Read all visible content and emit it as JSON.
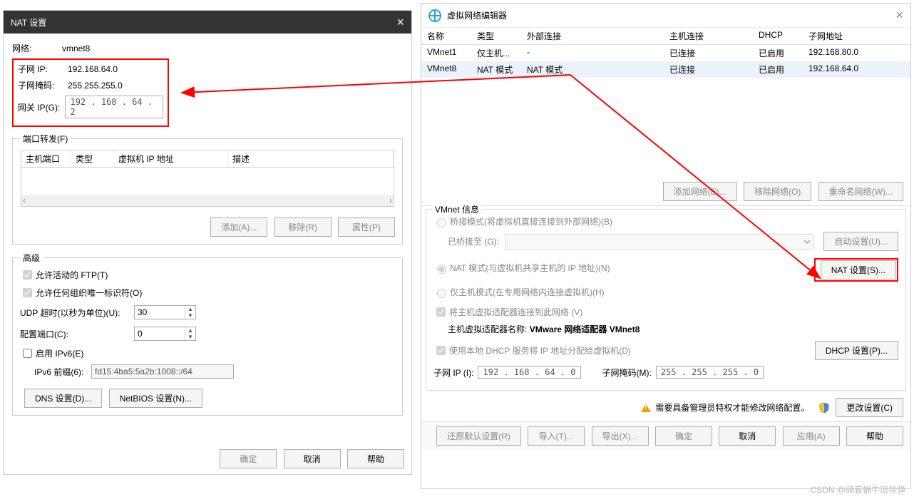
{
  "nat": {
    "title": "NAT 设置",
    "network_label": "网络:",
    "network_value": "vmnet8",
    "subnet_ip_label": "子网 IP:",
    "subnet_ip_value": "192.168.64.0",
    "subnet_mask_label": "子网掩码:",
    "subnet_mask_value": "255.255.255.0",
    "gateway_label": "网关 IP(G):",
    "gateway_value": "192 . 168 . 64  .  2",
    "port_fwd_legend": "端口转发(F)",
    "port_cols": {
      "host": "主机端口",
      "type": "类型",
      "vm_ip": "虚拟机 IP 地址",
      "desc": "描述"
    },
    "add_btn": "添加(A)...",
    "remove_btn": "移除(R)",
    "props_btn": "属性(P)",
    "advanced_legend": "高级",
    "allow_ftp": "允许活动的 FTP(T)",
    "allow_org": "允许任何组织唯一标识符(O)",
    "udp_timeout_label": "UDP 超时(以秒为单位)(U):",
    "udp_timeout_value": "30",
    "config_port_label": "配置端口(C):",
    "config_port_value": "0",
    "enable_ipv6": "启用 IPv6(E)",
    "ipv6_prefix_label": "IPv6 前缀(6):",
    "ipv6_prefix_value": "fd15:4ba5:5a2b:1008::/64",
    "dns_btn": "DNS 设置(D)...",
    "netbios_btn": "NetBIOS 设置(N)...",
    "ok": "确定",
    "cancel": "取消",
    "help": "帮助"
  },
  "vne": {
    "title": "虚拟网络编辑器",
    "cols": {
      "name": "名称",
      "type": "类型",
      "ext": "外部连接",
      "host": "主机连接",
      "dhcp": "DHCP",
      "subnet": "子网地址"
    },
    "rows": [
      {
        "name": "VMnet1",
        "type": "仅主机...",
        "ext": "-",
        "host": "已连接",
        "dhcp": "已启用",
        "subnet": "192.168.80.0"
      },
      {
        "name": "VMnet8",
        "type": "NAT 模式",
        "ext": "NAT 模式",
        "host": "已连接",
        "dhcp": "已启用",
        "subnet": "192.168.64.0"
      }
    ],
    "add_net": "添加网络(E)...",
    "remove_net": "移除网络(O)",
    "rename_net": "重命名网络(W)...",
    "info_label": "VMnet 信息",
    "bridge": "桥接模式(将虚拟机直接连接到外部网络)(B)",
    "bridge_to": "已桥接至 (G):",
    "auto_set": "自动设置(U)...",
    "nat_mode": "NAT 模式(与虚拟机共享主机的 IP 地址)(N)",
    "nat_set": "NAT 设置(S)...",
    "host_only": "仅主机模式(在专用网络内连接虚拟机)(H)",
    "host_adapter_chk": "将主机虚拟适配器连接到此网络 (V)",
    "host_adapter_name_label": "主机虚拟适配器名称:",
    "host_adapter_name_value": "VMware 网络适配器 VMnet8",
    "dhcp_chk": "使用本地 DHCP 服务将 IP 地址分配给虚拟机(D)",
    "dhcp_set": "DHCP 设置(P)...",
    "subnet_ip_label": "子网 IP (I):",
    "subnet_ip_value": "192 . 168 . 64 . 0",
    "subnet_mask_label": "子网掩码(M):",
    "subnet_mask_value": "255 . 255 . 255 . 0",
    "warn": "需要具备管理员特权才能修改网络配置。",
    "change_set": "更改设置(C)",
    "restore": "还原默认设置(R)",
    "import": "导入(T)...",
    "export": "导出(X)...",
    "ok": "确定",
    "cancel": "取消",
    "apply": "应用(A)",
    "help": "帮助"
  },
  "watermark": "CSDN @骑着蜗牛追导弹"
}
